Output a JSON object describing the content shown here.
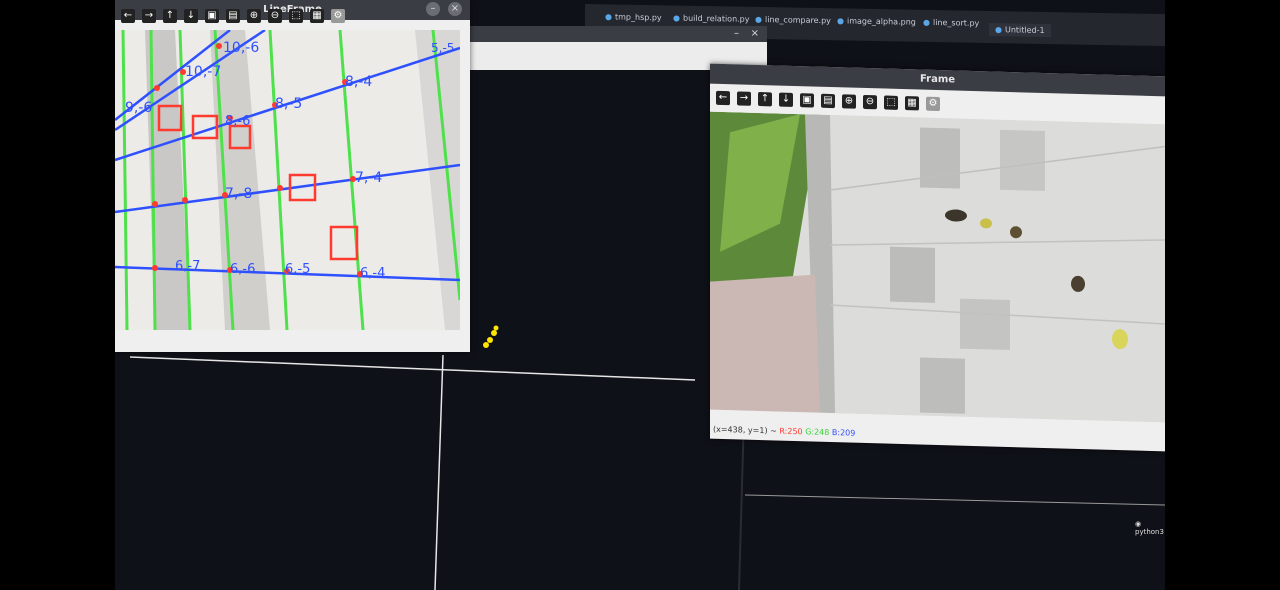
{
  "editor_tabs": [
    {
      "label": "tmp_hsp.py"
    },
    {
      "label": "build_relation.py"
    },
    {
      "label": "line_compare.py"
    },
    {
      "label": "image_alpha.png"
    },
    {
      "label": "line_sort.py"
    },
    {
      "label": "Untitled-1",
      "active": true
    }
  ],
  "left_window": {
    "title": "LineFrame",
    "annotations": [
      "10,-6",
      "10,-7",
      "5,-5",
      "8,-4",
      "8,-5",
      "7,-4",
      "7,-8",
      "6,-6",
      "6,-5",
      "6,-4",
      "6,-7",
      "8,-6",
      "9,-6"
    ]
  },
  "right_window": {
    "title": "Frame",
    "status": {
      "coords": "(x=438, y=1) ~",
      "r": "R:250",
      "g": "G:248",
      "b": "B:209"
    }
  },
  "toolbar_icons": [
    "arrow-left-icon",
    "arrow-right-icon",
    "arrow-up-icon",
    "arrow-down-icon",
    "save-region-icon",
    "save-image-icon",
    "zoom-in-icon",
    "zoom-out-icon",
    "zoom-fit-icon",
    "copy-icon",
    "panel-icon",
    "settings-icon"
  ],
  "terminal_label": "python3",
  "colors": {
    "lane_green": "#4fe14b",
    "line_blue": "#2f50ff",
    "box_red": "#ff3b2f",
    "marker_yellow": "#ffe600"
  }
}
